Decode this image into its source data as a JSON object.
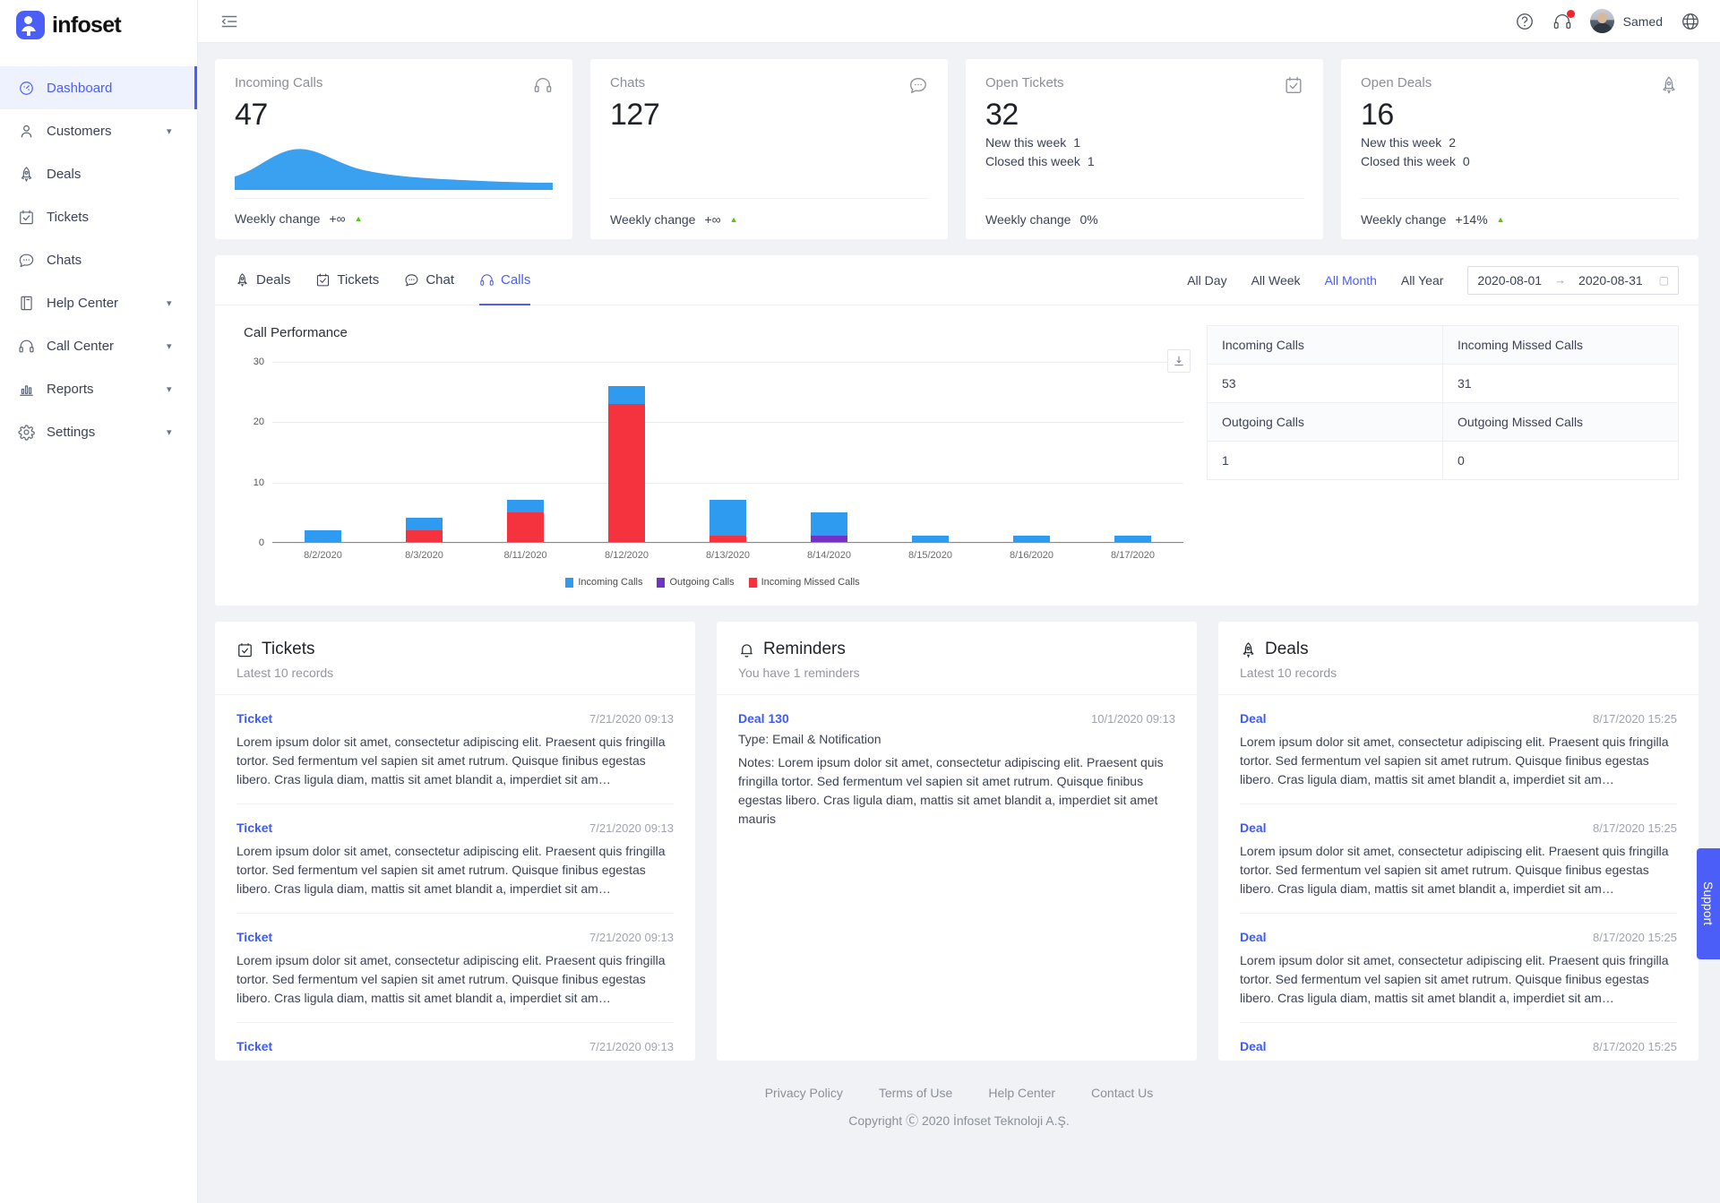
{
  "brand": {
    "name": "infoset"
  },
  "sidebar": {
    "items": [
      {
        "label": "Dashboard",
        "icon": "gauge-icon",
        "active": true,
        "expandable": false
      },
      {
        "label": "Customers",
        "icon": "user-icon",
        "active": false,
        "expandable": true
      },
      {
        "label": "Deals",
        "icon": "rocket-icon",
        "active": false,
        "expandable": false
      },
      {
        "label": "Tickets",
        "icon": "ticket-icon",
        "active": false,
        "expandable": false
      },
      {
        "label": "Chats",
        "icon": "chat-icon",
        "active": false,
        "expandable": false
      },
      {
        "label": "Help Center",
        "icon": "book-icon",
        "active": false,
        "expandable": true
      },
      {
        "label": "Call Center",
        "icon": "headset-icon",
        "active": false,
        "expandable": true
      },
      {
        "label": "Reports",
        "icon": "bar-chart-icon",
        "active": false,
        "expandable": true
      },
      {
        "label": "Settings",
        "icon": "gear-icon",
        "active": false,
        "expandable": true
      }
    ]
  },
  "topbar": {
    "collapse_icon": "menu-fold-icon",
    "help_icon": "question-circle-icon",
    "calls_icon": "headset-icon",
    "has_notification": true,
    "user_name": "Samed",
    "language_icon": "globe-icon"
  },
  "kpis": [
    {
      "title": "Incoming Calls",
      "value": "47",
      "icon": "headset-icon",
      "lines": [],
      "change_label": "Weekly change",
      "change_value": "+∞",
      "trend": "up",
      "has_spark": true
    },
    {
      "title": "Chats",
      "value": "127",
      "icon": "chat-icon",
      "lines": [],
      "change_label": "Weekly change",
      "change_value": "+∞",
      "trend": "up",
      "has_spark": false
    },
    {
      "title": "Open Tickets",
      "value": "32",
      "icon": "ticket-icon",
      "lines": [
        {
          "label": "New this week",
          "value": "1"
        },
        {
          "label": "Closed this week",
          "value": "1"
        }
      ],
      "change_label": "Weekly change",
      "change_value": "0%",
      "trend": "none",
      "has_spark": false
    },
    {
      "title": "Open Deals",
      "value": "16",
      "icon": "rocket-icon",
      "lines": [
        {
          "label": "New this week",
          "value": "2"
        },
        {
          "label": "Closed this week",
          "value": "0"
        }
      ],
      "change_label": "Weekly change",
      "change_value": "+14%",
      "trend": "up",
      "has_spark": false
    }
  ],
  "panel": {
    "tabs": [
      {
        "label": "Deals",
        "icon": "rocket-icon",
        "active": false
      },
      {
        "label": "Tickets",
        "icon": "ticket-icon",
        "active": false
      },
      {
        "label": "Chat",
        "icon": "chat-icon",
        "active": false
      },
      {
        "label": "Calls",
        "icon": "headset-icon",
        "active": true
      }
    ],
    "filters": [
      {
        "label": "All Day",
        "active": false
      },
      {
        "label": "All Week",
        "active": false
      },
      {
        "label": "All Month",
        "active": true
      },
      {
        "label": "All Year",
        "active": false
      }
    ],
    "date_start": "2020-08-01",
    "date_end": "2020-08-31",
    "date_arrow": "→",
    "download_icon": "download-icon",
    "table": {
      "rows": [
        [
          "Incoming Calls",
          "Incoming Missed Calls"
        ],
        [
          "53",
          "31"
        ],
        [
          "Outgoing Calls",
          "Outgoing Missed Calls"
        ],
        [
          "1",
          "0"
        ]
      ]
    }
  },
  "chart_data": {
    "type": "bar",
    "title": "Call Performance",
    "stacked": true,
    "categories": [
      "8/2/2020",
      "8/3/2020",
      "8/11/2020",
      "8/12/2020",
      "8/13/2020",
      "8/14/2020",
      "8/15/2020",
      "8/16/2020",
      "8/17/2020"
    ],
    "series": [
      {
        "name": "Incoming Calls",
        "color": "#2e9bf0",
        "values": [
          2,
          2,
          2,
          3,
          6,
          4,
          1,
          1,
          1
        ]
      },
      {
        "name": "Outgoing Calls",
        "color": "#7232c7",
        "values": [
          0,
          0,
          0,
          0,
          0,
          1,
          0,
          0,
          0
        ]
      },
      {
        "name": "Incoming Missed Calls",
        "color": "#f5333f",
        "values": [
          0,
          2,
          5,
          23,
          1,
          0,
          0,
          0,
          0
        ]
      }
    ],
    "totals": [
      2,
      4,
      7,
      26,
      7,
      5,
      1,
      1,
      1
    ],
    "yticks": [
      0,
      10,
      20,
      30
    ],
    "ylim": [
      0,
      30
    ],
    "xlabel": "",
    "ylabel": "",
    "grid": true,
    "legend_position": "bottom"
  },
  "tickets_panel": {
    "title": "Tickets",
    "icon": "ticket-icon",
    "subtitle": "Latest 10 records",
    "records": [
      {
        "link": "Ticket",
        "date": "7/21/2020 09:13",
        "text": "Lorem ipsum dolor sit amet, consectetur adipiscing elit. Praesent quis fringilla tortor. Sed fermentum vel sapien sit amet rutrum. Quisque finibus egestas libero. Cras ligula diam, mattis sit amet blandit a, imperdiet sit am…"
      },
      {
        "link": "Ticket",
        "date": "7/21/2020 09:13",
        "text": "Lorem ipsum dolor sit amet, consectetur adipiscing elit. Praesent quis fringilla tortor. Sed fermentum vel sapien sit amet rutrum. Quisque finibus egestas libero. Cras ligula diam, mattis sit amet blandit a, imperdiet sit am…"
      },
      {
        "link": "Ticket",
        "date": "7/21/2020 09:13",
        "text": "Lorem ipsum dolor sit amet, consectetur adipiscing elit. Praesent quis fringilla tortor. Sed fermentum vel sapien sit amet rutrum. Quisque finibus egestas libero. Cras ligula diam, mattis sit amet blandit a, imperdiet sit am…"
      },
      {
        "link": "Ticket",
        "date": "7/21/2020 09:13",
        "text": ""
      }
    ]
  },
  "reminders_panel": {
    "title": "Reminders",
    "icon": "bell-icon",
    "subtitle": "You have 1 reminders",
    "records": [
      {
        "link": "Deal 130",
        "date": "10/1/2020 09:13",
        "type": "Type: Email & Notification",
        "text": "Notes: Lorem ipsum dolor sit amet, consectetur adipiscing elit. Praesent quis fringilla tortor. Sed fermentum vel sapien sit amet rutrum. Quisque finibus egestas libero. Cras ligula diam, mattis sit amet blandit a, imperdiet sit amet mauris"
      }
    ]
  },
  "deals_panel": {
    "title": "Deals",
    "icon": "rocket-icon",
    "subtitle": "Latest 10 records",
    "records": [
      {
        "link": "Deal",
        "date": "8/17/2020 15:25",
        "text": "Lorem ipsum dolor sit amet, consectetur adipiscing elit. Praesent quis fringilla tortor. Sed fermentum vel sapien sit amet rutrum. Quisque finibus egestas libero. Cras ligula diam, mattis sit amet blandit a, imperdiet sit am…"
      },
      {
        "link": "Deal",
        "date": "8/17/2020 15:25",
        "text": "Lorem ipsum dolor sit amet, consectetur adipiscing elit. Praesent quis fringilla tortor. Sed fermentum vel sapien sit amet rutrum. Quisque finibus egestas libero. Cras ligula diam, mattis sit amet blandit a, imperdiet sit am…"
      },
      {
        "link": "Deal",
        "date": "8/17/2020 15:25",
        "text": "Lorem ipsum dolor sit amet, consectetur adipiscing elit. Praesent quis fringilla tortor. Sed fermentum vel sapien sit amet rutrum. Quisque finibus egestas libero. Cras ligula diam, mattis sit amet blandit a, imperdiet sit am…"
      },
      {
        "link": "Deal",
        "date": "8/17/2020 15:25",
        "text": ""
      }
    ]
  },
  "footer": {
    "links": [
      "Privacy Policy",
      "Terms of Use",
      "Help Center",
      "Contact Us"
    ],
    "copyright": "Copyright Ⓒ 2020 İnfoset Teknoloji A.Ş."
  },
  "support_tab": {
    "label": "Support"
  },
  "colors": {
    "accent": "#4b5ef7",
    "incoming": "#2e9bf0",
    "outgoing": "#7232c7",
    "missed": "#f5333f",
    "up": "#52c41a"
  }
}
